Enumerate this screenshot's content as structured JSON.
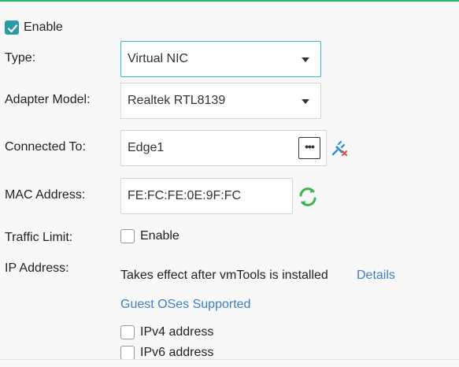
{
  "enable": {
    "label": "Enable",
    "checked": true
  },
  "type": {
    "label": "Type:",
    "value": "Virtual NIC"
  },
  "adapter_model": {
    "label": "Adapter Model:",
    "value": "Realtek RTL8139"
  },
  "connected_to": {
    "label": "Connected To:",
    "value": "Edge1",
    "browse_label": "•••"
  },
  "mac_address": {
    "label": "MAC Address:",
    "value": "FE:FC:FE:0E:9F:FC"
  },
  "traffic_limit": {
    "label": "Traffic Limit:",
    "enable_label": "Enable",
    "checked": false
  },
  "ip_address": {
    "label": "IP Address:",
    "note": "Takes effect after vmTools is installed",
    "details_link": "Details",
    "guest_os_link": "Guest OSes Supported",
    "ipv4_label": "IPv4 address",
    "ipv6_label": "IPv6 address"
  },
  "colors": {
    "accent": "#2b9aa4",
    "link": "#3d7fc7",
    "refresh": "#3cb54a",
    "focus": "#3ab8c5"
  }
}
